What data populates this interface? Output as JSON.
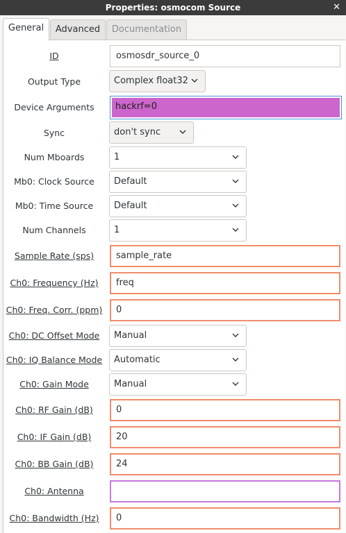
{
  "window": {
    "title": "Properties: osmocom Source",
    "close_glyph": "✕"
  },
  "tabs": [
    {
      "label": "General",
      "state": "active"
    },
    {
      "label": "Advanced",
      "state": "normal"
    },
    {
      "label": "Documentation",
      "state": "disabled"
    }
  ],
  "fields": {
    "id": {
      "label": "ID",
      "value": "osmosdr_source_0"
    },
    "output_type": {
      "label": "Output Type",
      "value": "Complex float32"
    },
    "device_args": {
      "label": "Device Arguments",
      "value": "hackrf=0"
    },
    "sync": {
      "label": "Sync",
      "value": "don't sync"
    },
    "num_mboards": {
      "label": "Num Mboards",
      "value": "1"
    },
    "clock_source": {
      "label": "Mb0: Clock Source",
      "value": "Default"
    },
    "time_source": {
      "label": "Mb0: Time Source",
      "value": "Default"
    },
    "num_channels": {
      "label": "Num Channels",
      "value": "1"
    },
    "sample_rate": {
      "label": "Sample Rate (sps)",
      "value": "sample_rate"
    },
    "freq": {
      "label": "Ch0: Frequency (Hz)",
      "value": "freq"
    },
    "freq_corr": {
      "label": "Ch0: Freq. Corr. (ppm)",
      "value": "0"
    },
    "dc_offset": {
      "label": "Ch0: DC Offset Mode",
      "value": "Manual"
    },
    "iq_balance": {
      "label": "Ch0: IQ Balance Mode",
      "value": "Automatic"
    },
    "gain_mode": {
      "label": "Ch0: Gain Mode",
      "value": "Manual"
    },
    "rf_gain": {
      "label": "Ch0: RF Gain (dB)",
      "value": "0"
    },
    "if_gain": {
      "label": "Ch0: IF Gain (dB)",
      "value": "20"
    },
    "bb_gain": {
      "label": "Ch0: BB Gain (dB)",
      "value": "24"
    },
    "antenna": {
      "label": "Ch0: Antenna",
      "value": ""
    },
    "bandwidth": {
      "label": "Ch0: Bandwidth (Hz)",
      "value": "0"
    }
  },
  "colors": {
    "error_border": "#f08c6a",
    "selection": "#cc66cc",
    "focus": "#4a90d9",
    "antenna_border": "#c678dd"
  }
}
